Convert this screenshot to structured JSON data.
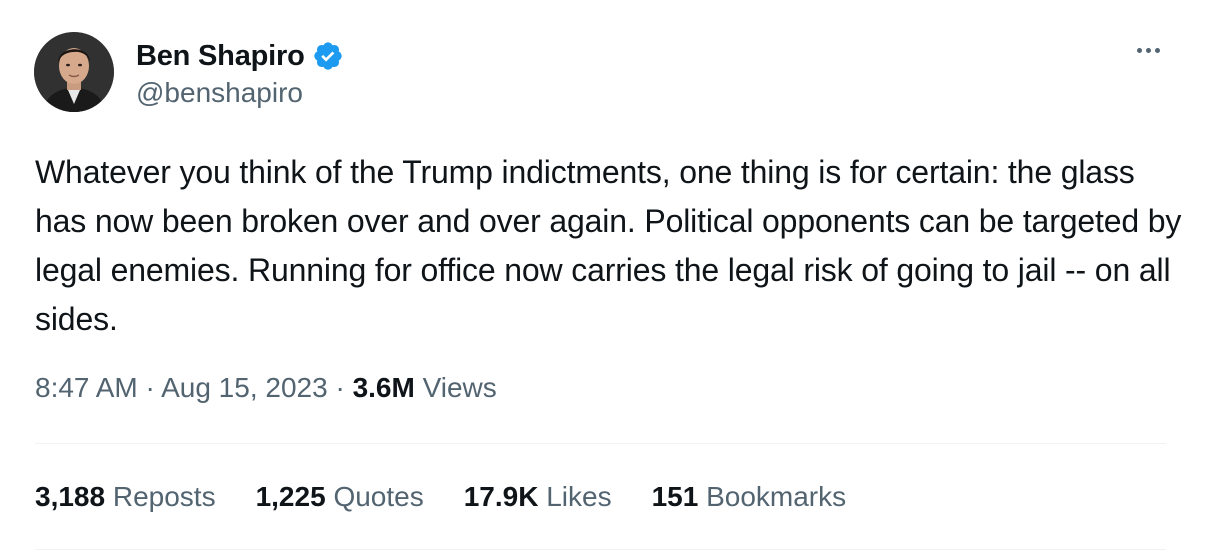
{
  "author": {
    "display_name": "Ben Shapiro",
    "handle": "@benshapiro",
    "verified_icon": "verified-badge-icon",
    "avatar": "profile-photo"
  },
  "tweet": {
    "text": "Whatever you think of the Trump indictments, one thing is for certain: the glass has now been broken over and over again. Political opponents can be targeted by legal enemies. Running for office now carries the legal risk of going to jail -- on all sides."
  },
  "meta": {
    "time": "8:47 AM",
    "sep1": "·",
    "date": "Aug 15, 2023",
    "sep2": "·",
    "views_count": "3.6M",
    "views_label": "Views"
  },
  "stats": [
    {
      "count": "3,188",
      "label": "Reposts"
    },
    {
      "count": "1,225",
      "label": "Quotes"
    },
    {
      "count": "17.9K",
      "label": "Likes"
    },
    {
      "count": "151",
      "label": "Bookmarks"
    }
  ],
  "colors": {
    "text_primary": "#0f1419",
    "text_secondary": "#536471",
    "verified_blue": "#1d9bf0",
    "divider": "#eff3f4"
  }
}
